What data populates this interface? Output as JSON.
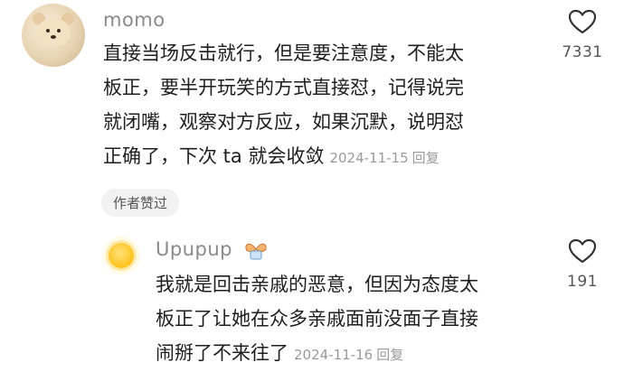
{
  "comment": {
    "username": "momo",
    "lines": [
      "直接当场反击就行，但是要注意度，不能太",
      "板正，要半开玩笑的方式直接怼，记得说完",
      "就闭嘴，观察对方反应，如果沉默，说明怼",
      "正确了，下次 ta 就会收敛"
    ],
    "date": "2024-11-15",
    "reply_label": "回复",
    "likes": "7331",
    "author_badge": "作者赞过"
  },
  "reply": {
    "username": "Upupup",
    "lines": [
      "我就是回击亲戚的恶意，但因为态度太",
      "板正了让她在众多亲戚面前没面子直接",
      "闹掰了不来往了"
    ],
    "date": "2024-11-16",
    "reply_label": "回复",
    "likes": "191"
  },
  "icons": {
    "like": "heart-outline-icon",
    "avatar_main": "teddy-bear-avatar",
    "avatar_reply": "sun-avatar",
    "name_decoration": "bow-decoration-icon"
  },
  "colors": {
    "text": "#1e1e1e",
    "meta": "#9a9a9a",
    "username": "#8a8a8a",
    "badge_bg": "#f2f2f2"
  }
}
